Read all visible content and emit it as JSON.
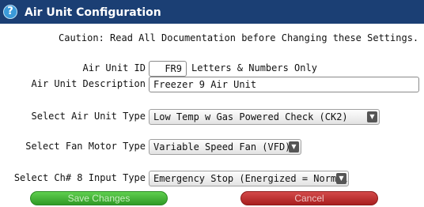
{
  "window": {
    "title": "Air Unit Configuration"
  },
  "caution": "Caution: Read All Documentation before Changing these Settings.",
  "fields": {
    "unit_id": {
      "label": "Air Unit ID",
      "value": "FR9",
      "hint": "Letters & Numbers Only"
    },
    "description": {
      "label": "Air Unit Description",
      "value": "Freezer 9 Air Unit"
    },
    "unit_type": {
      "label": "Select Air Unit Type",
      "value": "Low Temp w Gas Powered Check (CK2)"
    },
    "fan_motor_type": {
      "label": "Select Fan Motor Type",
      "value": "Variable Speed Fan (VFD)"
    },
    "ch8_input_type": {
      "label": "Select Ch# 8 Input Type",
      "value": "Emergency Stop (Energized = Normal)"
    }
  },
  "buttons": {
    "save": "Save Changes",
    "cancel": "Cancel"
  },
  "icons": {
    "help": "?",
    "dropdown": "▼"
  },
  "colors": {
    "titlebar": "#1b3f74",
    "save": "#3fb233",
    "cancel": "#c02e2e"
  }
}
